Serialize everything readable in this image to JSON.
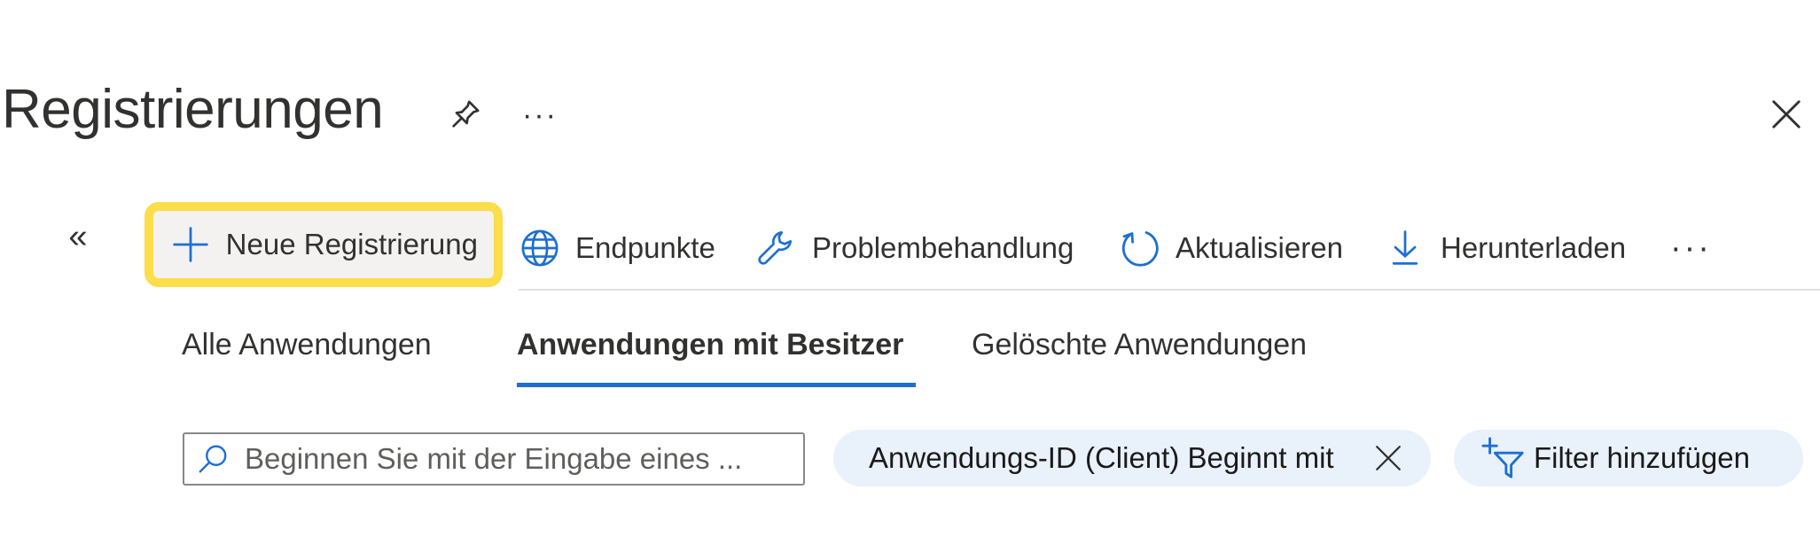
{
  "header": {
    "title": "Registrierungen",
    "more_glyph": "···",
    "icons": [
      "pin-icon",
      "close-icon"
    ]
  },
  "nav": {
    "collapse_glyph": "«"
  },
  "toolbar": {
    "new_registration": "Neue Registrierung",
    "endpoints": "Endpunkte",
    "troubleshooting": "Problembehandlung",
    "refresh": "Aktualisieren",
    "download": "Herunterladen",
    "more_glyph": "···",
    "icons": [
      "plus-icon",
      "globe-icon",
      "wrench-icon",
      "refresh-icon",
      "download-icon"
    ],
    "highlight_color": "#fcdd4a"
  },
  "tabs": [
    {
      "label": "Alle Anwendungen",
      "active": false
    },
    {
      "label": "Anwendungen mit Besitzer",
      "active": true
    },
    {
      "label": "Gelöschte Anwendungen",
      "active": false
    }
  ],
  "search": {
    "placeholder": "Beginnen Sie mit der Eingabe eines ...",
    "value": ""
  },
  "filters": {
    "active_filter": "Anwendungs-ID (Client) Beginnt mit",
    "add_filter": "Filter hinzufügen"
  },
  "colors": {
    "accent": "#1e6fd0",
    "pill_bg": "#e9f1fb"
  }
}
